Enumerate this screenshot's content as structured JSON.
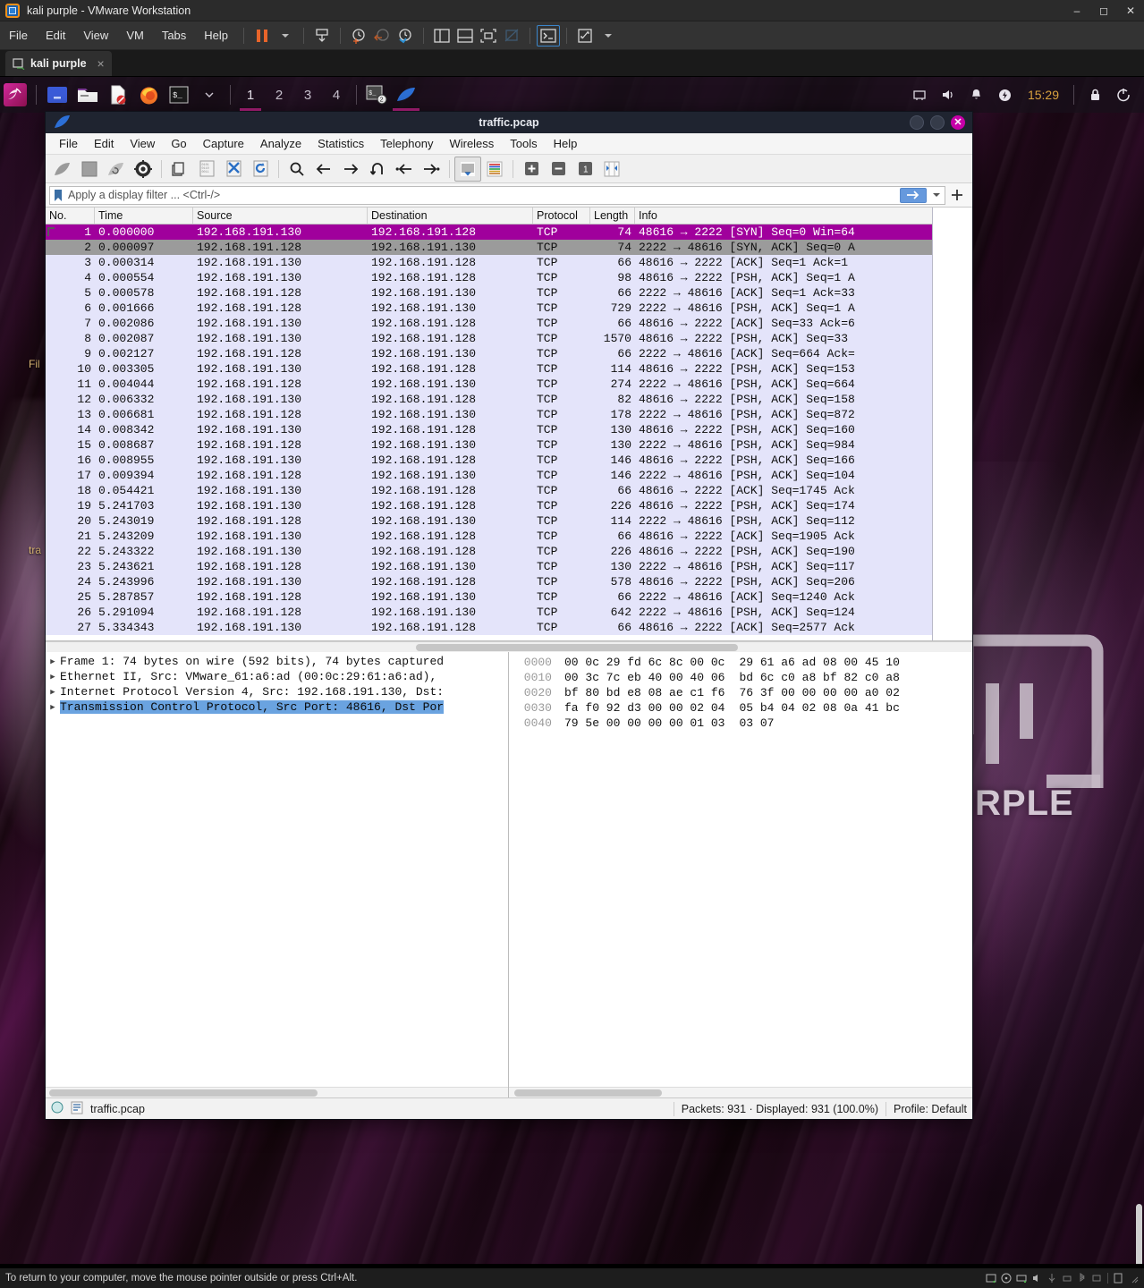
{
  "vmware": {
    "title": "kali purple - VMware Workstation",
    "app_icon": "vmware-icon",
    "menu": [
      "File",
      "Edit",
      "View",
      "VM",
      "Tabs",
      "Help"
    ],
    "toolbar_icons": [
      "pause-icon",
      "dropdown-arrow-icon",
      "snapshot-icon",
      "snapshot-take-icon",
      "snapshot-revert-icon",
      "snapshot-manager-icon",
      "view-side-by-side-icon",
      "view-stacked-icon",
      "fullscreen-icon",
      "unity-mode-icon",
      "console-icon",
      "expand-icon",
      "expand-dropdown-icon"
    ],
    "window_buttons": [
      "minimize",
      "maximize",
      "close"
    ],
    "tab": {
      "label": "kali purple",
      "close": "×"
    },
    "status": "To return to your computer, move the mouse pointer outside or press Ctrl+Alt."
  },
  "kali_panel": {
    "launcher": "kali-dragon-icon",
    "quick_launch": [
      "files-blue-icon",
      "file-manager-icon",
      "text-editor-icon",
      "firefox-icon",
      "terminal-icon"
    ],
    "terminal_dropdown": "chevron-down-icon",
    "workspaces": [
      "1",
      "2",
      "3",
      "4"
    ],
    "active_workspace": "1",
    "tasks": [
      {
        "name": "terminal-task",
        "badge": "2"
      },
      {
        "name": "wireshark-task",
        "badge": ""
      }
    ],
    "tray": [
      "network-icon",
      "volume-icon",
      "notification-bell-icon",
      "power-flash-icon"
    ],
    "clock": "15:29",
    "session": [
      "lock-icon",
      "logout-icon"
    ]
  },
  "desktop": {
    "icon_labels": [
      "Fil",
      "tra"
    ],
    "watermark": "RPLE"
  },
  "wireshark": {
    "title": "traffic.pcap",
    "app_icon": "wireshark-fin-icon",
    "window_buttons": {
      "minimize": "",
      "maximize": "",
      "close": "✕"
    },
    "menu": [
      "File",
      "Edit",
      "View",
      "Go",
      "Capture",
      "Analyze",
      "Statistics",
      "Telephony",
      "Wireless",
      "Tools",
      "Help"
    ],
    "toolbar_icons": [
      "start-capture-icon",
      "stop-capture-icon",
      "restart-capture-icon",
      "capture-options-icon",
      "open-file-icon",
      "save-file-icon",
      "close-file-icon",
      "reload-file-icon",
      "find-packet-icon",
      "go-back-icon",
      "go-forward-icon",
      "go-to-packet-icon",
      "go-first-packet-icon",
      "go-last-packet-icon",
      "auto-scroll-icon",
      "colorize-icon",
      "zoom-in-icon",
      "zoom-out-icon",
      "zoom-reset-icon",
      "resize-columns-icon"
    ],
    "filter": {
      "bookmark_icon": "bookmark-icon",
      "placeholder": "Apply a display filter ... <Ctrl-/>",
      "value": "",
      "apply_icon": "arrow-right-icon",
      "dropdown_icon": "chevron-down-icon",
      "add_icon": "plus-icon"
    },
    "packet_columns": [
      "No.",
      "Time",
      "Source",
      "Destination",
      "Protocol",
      "Length",
      "Info"
    ],
    "packets": [
      {
        "no": "1",
        "time": "0.000000",
        "src": "192.168.191.130",
        "dst": "192.168.191.128",
        "proto": "TCP",
        "len": "74",
        "info": "48616 → 2222 [SYN] Seq=0 Win=64",
        "state": "selected"
      },
      {
        "no": "2",
        "time": "0.000097",
        "src": "192.168.191.128",
        "dst": "192.168.191.130",
        "proto": "TCP",
        "len": "74",
        "info": "2222 → 48616 [SYN, ACK] Seq=0 A",
        "state": "related"
      },
      {
        "no": "3",
        "time": "0.000314",
        "src": "192.168.191.130",
        "dst": "192.168.191.128",
        "proto": "TCP",
        "len": "66",
        "info": "48616 → 2222 [ACK] Seq=1 Ack=1",
        "state": ""
      },
      {
        "no": "4",
        "time": "0.000554",
        "src": "192.168.191.130",
        "dst": "192.168.191.128",
        "proto": "TCP",
        "len": "98",
        "info": "48616 → 2222 [PSH, ACK] Seq=1 A",
        "state": ""
      },
      {
        "no": "5",
        "time": "0.000578",
        "src": "192.168.191.128",
        "dst": "192.168.191.130",
        "proto": "TCP",
        "len": "66",
        "info": "2222 → 48616 [ACK] Seq=1 Ack=33",
        "state": ""
      },
      {
        "no": "6",
        "time": "0.001666",
        "src": "192.168.191.128",
        "dst": "192.168.191.130",
        "proto": "TCP",
        "len": "729",
        "info": "2222 → 48616 [PSH, ACK] Seq=1 A",
        "state": ""
      },
      {
        "no": "7",
        "time": "0.002086",
        "src": "192.168.191.130",
        "dst": "192.168.191.128",
        "proto": "TCP",
        "len": "66",
        "info": "48616 → 2222 [ACK] Seq=33 Ack=6",
        "state": ""
      },
      {
        "no": "8",
        "time": "0.002087",
        "src": "192.168.191.130",
        "dst": "192.168.191.128",
        "proto": "TCP",
        "len": "1570",
        "info": "48616 → 2222 [PSH, ACK] Seq=33",
        "state": ""
      },
      {
        "no": "9",
        "time": "0.002127",
        "src": "192.168.191.128",
        "dst": "192.168.191.130",
        "proto": "TCP",
        "len": "66",
        "info": "2222 → 48616 [ACK] Seq=664 Ack=",
        "state": ""
      },
      {
        "no": "10",
        "time": "0.003305",
        "src": "192.168.191.130",
        "dst": "192.168.191.128",
        "proto": "TCP",
        "len": "114",
        "info": "48616 → 2222 [PSH, ACK] Seq=153",
        "state": ""
      },
      {
        "no": "11",
        "time": "0.004044",
        "src": "192.168.191.128",
        "dst": "192.168.191.130",
        "proto": "TCP",
        "len": "274",
        "info": "2222 → 48616 [PSH, ACK] Seq=664",
        "state": ""
      },
      {
        "no": "12",
        "time": "0.006332",
        "src": "192.168.191.130",
        "dst": "192.168.191.128",
        "proto": "TCP",
        "len": "82",
        "info": "48616 → 2222 [PSH, ACK] Seq=158",
        "state": ""
      },
      {
        "no": "13",
        "time": "0.006681",
        "src": "192.168.191.128",
        "dst": "192.168.191.130",
        "proto": "TCP",
        "len": "178",
        "info": "2222 → 48616 [PSH, ACK] Seq=872",
        "state": ""
      },
      {
        "no": "14",
        "time": "0.008342",
        "src": "192.168.191.130",
        "dst": "192.168.191.128",
        "proto": "TCP",
        "len": "130",
        "info": "48616 → 2222 [PSH, ACK] Seq=160",
        "state": ""
      },
      {
        "no": "15",
        "time": "0.008687",
        "src": "192.168.191.128",
        "dst": "192.168.191.130",
        "proto": "TCP",
        "len": "130",
        "info": "2222 → 48616 [PSH, ACK] Seq=984",
        "state": ""
      },
      {
        "no": "16",
        "time": "0.008955",
        "src": "192.168.191.130",
        "dst": "192.168.191.128",
        "proto": "TCP",
        "len": "146",
        "info": "48616 → 2222 [PSH, ACK] Seq=166",
        "state": ""
      },
      {
        "no": "17",
        "time": "0.009394",
        "src": "192.168.191.128",
        "dst": "192.168.191.130",
        "proto": "TCP",
        "len": "146",
        "info": "2222 → 48616 [PSH, ACK] Seq=104",
        "state": ""
      },
      {
        "no": "18",
        "time": "0.054421",
        "src": "192.168.191.130",
        "dst": "192.168.191.128",
        "proto": "TCP",
        "len": "66",
        "info": "48616 → 2222 [ACK] Seq=1745 Ack",
        "state": ""
      },
      {
        "no": "19",
        "time": "5.241703",
        "src": "192.168.191.130",
        "dst": "192.168.191.128",
        "proto": "TCP",
        "len": "226",
        "info": "48616 → 2222 [PSH, ACK] Seq=174",
        "state": ""
      },
      {
        "no": "20",
        "time": "5.243019",
        "src": "192.168.191.128",
        "dst": "192.168.191.130",
        "proto": "TCP",
        "len": "114",
        "info": "2222 → 48616 [PSH, ACK] Seq=112",
        "state": ""
      },
      {
        "no": "21",
        "time": "5.243209",
        "src": "192.168.191.130",
        "dst": "192.168.191.128",
        "proto": "TCP",
        "len": "66",
        "info": "48616 → 2222 [ACK] Seq=1905 Ack",
        "state": ""
      },
      {
        "no": "22",
        "time": "5.243322",
        "src": "192.168.191.130",
        "dst": "192.168.191.128",
        "proto": "TCP",
        "len": "226",
        "info": "48616 → 2222 [PSH, ACK] Seq=190",
        "state": ""
      },
      {
        "no": "23",
        "time": "5.243621",
        "src": "192.168.191.128",
        "dst": "192.168.191.130",
        "proto": "TCP",
        "len": "130",
        "info": "2222 → 48616 [PSH, ACK] Seq=117",
        "state": ""
      },
      {
        "no": "24",
        "time": "5.243996",
        "src": "192.168.191.130",
        "dst": "192.168.191.128",
        "proto": "TCP",
        "len": "578",
        "info": "48616 → 2222 [PSH, ACK] Seq=206",
        "state": ""
      },
      {
        "no": "25",
        "time": "5.287857",
        "src": "192.168.191.128",
        "dst": "192.168.191.130",
        "proto": "TCP",
        "len": "66",
        "info": "2222 → 48616 [ACK] Seq=1240 Ack",
        "state": ""
      },
      {
        "no": "26",
        "time": "5.291094",
        "src": "192.168.191.128",
        "dst": "192.168.191.130",
        "proto": "TCP",
        "len": "642",
        "info": "2222 → 48616 [PSH, ACK] Seq=124",
        "state": ""
      },
      {
        "no": "27",
        "time": "5.334343",
        "src": "192.168.191.130",
        "dst": "192.168.191.128",
        "proto": "TCP",
        "len": "66",
        "info": "48616 → 2222 [ACK] Seq=2577 Ack",
        "state": ""
      }
    ],
    "detail_rows": [
      {
        "text": "Frame 1: 74 bytes on wire (592 bits), 74 bytes captured",
        "selected": false
      },
      {
        "text": "Ethernet II, Src: VMware_61:a6:ad (00:0c:29:61:a6:ad),",
        "selected": false
      },
      {
        "text": "Internet Protocol Version 4, Src: 192.168.191.130, Dst:",
        "selected": false
      },
      {
        "text": "Transmission Control Protocol, Src Port: 48616, Dst Por",
        "selected": true
      }
    ],
    "bytes_rows": [
      {
        "offset": "0000",
        "hex1": "00 0c 29 fd 6c 8c 00 0c",
        "hex2": "29 61 a6 ad 08 00 45 10"
      },
      {
        "offset": "0010",
        "hex1": "00 3c 7c eb 40 00 40 06",
        "hex2": "bd 6c c0 a8 bf 82 c0 a8"
      },
      {
        "offset": "0020",
        "hex1": "bf 80 bd e8 08 ae c1 f6",
        "hex2": "76 3f 00 00 00 00 a0 02"
      },
      {
        "offset": "0030",
        "hex1": "fa f0 92 d3 00 00 02 04",
        "hex2": "05 b4 04 02 08 0a 41 bc"
      },
      {
        "offset": "0040",
        "hex1": "79 5e 00 00 00 00 01 03",
        "hex2": "03 07"
      }
    ],
    "statusbar": {
      "expert_icon": "expert-info-icon",
      "capture_comment_icon": "capture-comment-icon",
      "file": "traffic.pcap",
      "packets": "Packets: 931 · Displayed: 931 (100.0%)",
      "profile": "Profile: Default"
    }
  },
  "colors": {
    "selected_row": "#a0009c",
    "related_row": "#9b9b9b",
    "packet_bg": "#e4e4fa",
    "detail_selection": "#6aa3e0",
    "kali_accent": "#b3207f",
    "clock": "#d9a23e"
  }
}
